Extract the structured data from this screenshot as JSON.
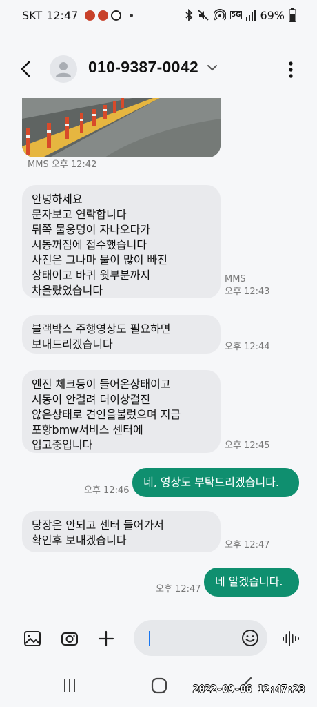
{
  "status_bar": {
    "carrier": "SKT",
    "time": "12:47",
    "battery": "69%",
    "network": "5G"
  },
  "header": {
    "title": "010-9387-0042",
    "icons": {
      "back": "back-arrow-icon",
      "avatar": "person-avatar-icon",
      "dropdown": "chevron-down-icon",
      "menu": "more-vert-icon"
    }
  },
  "messages": [
    {
      "direction": "in",
      "type": "image",
      "label": "MMS",
      "time": "오후 12:42"
    },
    {
      "direction": "in",
      "text": "안녕하세요\n문자보고 연락합니다\n뒤쪽 물웅덩이 자나오다가\n시동꺼짐에 접수했습니다\n사진은 그나마 물이 많이 빠진\n상태이고 바퀴 윗부분까지\n차올랐었습니다",
      "label": "MMS",
      "time": "오후 12:43"
    },
    {
      "direction": "in",
      "text": "블랙박스 주행영상도 필요하면\n보내드리겠습니다",
      "time": "오후 12:44"
    },
    {
      "direction": "in",
      "text": "엔진 체크등이 들어온상태이고\n시동이 안걸려 더이상걸진\n않은상태로 견인을불렀으며 지금\n포항bmw서비스 센터에\n입고중입니다",
      "time": "오후 12:45"
    },
    {
      "direction": "out",
      "text": "네, 영상도 부탁드리겠습니다.",
      "time": "오후 12:46"
    },
    {
      "direction": "in",
      "text": "당장은 안되고 센터 들어가서\n확인후 보내겠습니다",
      "time": "오후 12:47"
    },
    {
      "direction": "out",
      "text": "네 알겠습니다.",
      "time": "오후 12:47"
    }
  ],
  "input_bar": {
    "icons": [
      "gallery-icon",
      "camera-icon",
      "plus-icon",
      "emoji-icon",
      "voice-icon"
    ]
  },
  "nav_bar": {
    "icons": [
      "recent-apps-icon",
      "home-icon",
      "back-icon"
    ]
  },
  "overlay_timestamp": "2022-09-06 12:47:23",
  "colors": {
    "outgoing_bubble": "#0f8f6f",
    "incoming_bubble": "#e9eaed",
    "background": "#f6f7f9",
    "caret": "#1877f2"
  }
}
